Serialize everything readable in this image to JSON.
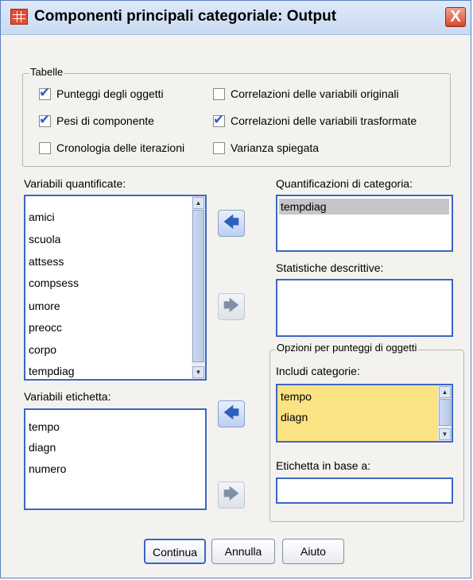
{
  "window": {
    "title": "Componenti principali categoriale: Output",
    "close_glyph": "X"
  },
  "tables_group": {
    "legend": "Tabelle",
    "checkboxes": [
      {
        "label": "Punteggi degli oggetti",
        "checked": true
      },
      {
        "label": "Pesi di componente",
        "checked": true
      },
      {
        "label": "Cronologia delle iterazioni",
        "checked": false
      },
      {
        "label": "Correlazioni delle variabili originali",
        "checked": false
      },
      {
        "label": "Correlazioni delle variabili trasformate",
        "checked": true
      },
      {
        "label": "Varianza spiegata",
        "checked": false
      }
    ]
  },
  "quantified_vars": {
    "label": "Variabili quantificate:",
    "items": [
      "amici",
      "scuola",
      "attsess",
      "compsess",
      "umore",
      "preocc",
      "corpo",
      "tempdiag"
    ]
  },
  "label_vars": {
    "label": "Variabili etichetta:",
    "items": [
      "tempo",
      "diagn",
      "numero"
    ]
  },
  "category_quant": {
    "label": "Quantificazioni di categoria:",
    "items": [
      "tempdiag"
    ]
  },
  "descriptive_stats": {
    "label": "Statistiche descrittive:"
  },
  "object_scores_group": {
    "legend": "Opzioni per punteggi di oggetti",
    "include_label": "Includi categorie:",
    "include_items": [
      "tempo",
      "diagn"
    ],
    "label_by": "Etichetta in base a:"
  },
  "buttons": {
    "continue": "Continua",
    "cancel": "Annulla",
    "help": "Aiuto"
  },
  "icons": {
    "app": "spss-grid-icon",
    "move_left": "arrow-left-icon",
    "move_right": "arrow-right-icon"
  }
}
